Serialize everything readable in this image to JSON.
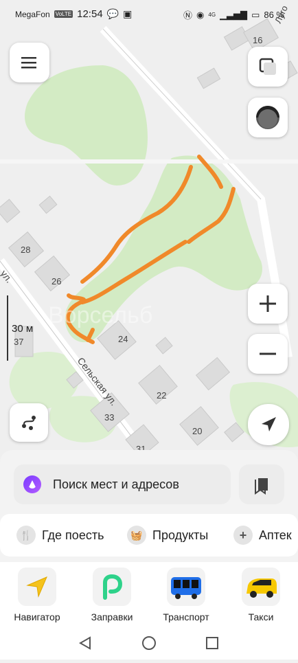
{
  "status_bar": {
    "carrier": "MegaFon",
    "volte": "VoLTE",
    "time": "12:54",
    "network": "4G",
    "battery": "86 %"
  },
  "map": {
    "house_numbers": [
      "16",
      "28",
      "26",
      "24",
      "22",
      "20",
      "37",
      "33",
      "31"
    ],
    "streets": [
      "Сельская ул.",
      "ул.",
      "Луго"
    ],
    "scale_label": "30 м",
    "watermark": "Ворсельб"
  },
  "search": {
    "placeholder": "Поиск мест и адресов"
  },
  "categories": [
    {
      "label": "Где поесть",
      "icon": "fork-knife-icon"
    },
    {
      "label": "Продукты",
      "icon": "basket-icon"
    },
    {
      "label": "Аптек",
      "icon": "plus-icon"
    }
  ],
  "apps": [
    {
      "label": "Навигатор",
      "icon": "navigator-icon"
    },
    {
      "label": "Заправки",
      "icon": "fuel-icon"
    },
    {
      "label": "Транспорт",
      "icon": "bus-icon"
    },
    {
      "label": "Такси",
      "icon": "taxi-icon"
    }
  ],
  "colors": {
    "park": "#cfe8c0",
    "track": "#f0892a",
    "accent": "#8a3cff"
  }
}
